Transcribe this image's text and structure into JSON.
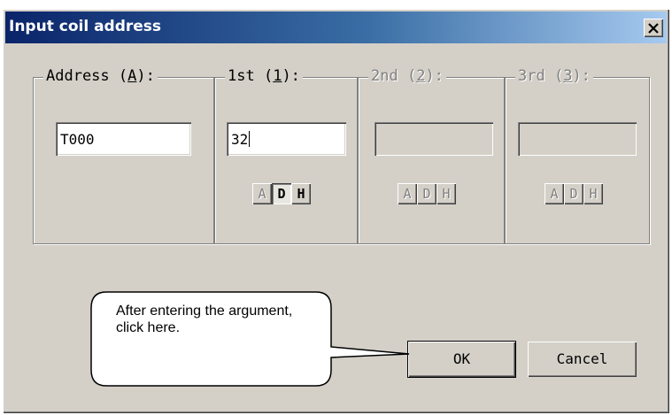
{
  "dialog": {
    "title": "Input coil address",
    "close_glyph": "close-icon"
  },
  "groups": {
    "address": {
      "label_pre": "Address (",
      "label_key": "A",
      "label_post": "):",
      "value": "T000"
    },
    "first": {
      "label_pre": "1st (",
      "label_key": "1",
      "label_post": "):",
      "value": "32"
    },
    "second": {
      "label_pre": "2nd (",
      "label_key": "2",
      "label_post": "):",
      "value": ""
    },
    "third": {
      "label_pre": "3rd (",
      "label_key": "3",
      "label_post": "):",
      "value": ""
    }
  },
  "radix": {
    "a": "A",
    "d": "D",
    "h": "H"
  },
  "buttons": {
    "ok": "OK",
    "cancel": "Cancel"
  },
  "callout": {
    "text": "After entering the argument, click here."
  }
}
